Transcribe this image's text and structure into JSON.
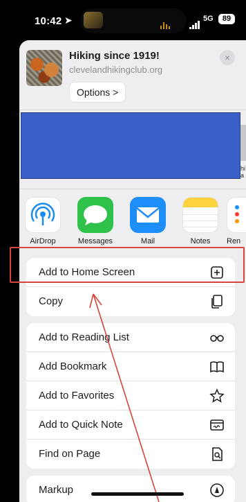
{
  "status_bar": {
    "time": "10:42",
    "network": "5G",
    "battery": "89"
  },
  "share_preview": {
    "title": "Hiking since 1919!",
    "url": "clevelandhikingclub.org",
    "options_label": "Options >",
    "close_symbol": "×"
  },
  "banner_peek_text": "hi\na",
  "apps": [
    {
      "label": "AirDrop",
      "icon": "airdrop-icon"
    },
    {
      "label": "Messages",
      "icon": "messages-icon"
    },
    {
      "label": "Mail",
      "icon": "mail-icon"
    },
    {
      "label": "Notes",
      "icon": "notes-icon"
    },
    {
      "label": "Ren",
      "icon": "reminders-icon"
    }
  ],
  "actions_group1": [
    {
      "label": "Add to Home Screen",
      "icon": "plus-square-icon"
    },
    {
      "label": "Copy",
      "icon": "copy-icon"
    }
  ],
  "actions_group2": [
    {
      "label": "Add to Reading List",
      "icon": "glasses-icon"
    },
    {
      "label": "Add Bookmark",
      "icon": "book-icon"
    },
    {
      "label": "Add to Favorites",
      "icon": "star-icon"
    },
    {
      "label": "Add to Quick Note",
      "icon": "quick-note-icon"
    },
    {
      "label": "Find on Page",
      "icon": "find-on-page-icon"
    }
  ],
  "actions_group3": [
    {
      "label": "Markup",
      "icon": "markup-icon"
    }
  ],
  "colors": {
    "annotation": "#d9443a",
    "banner": "#3a60c8",
    "messages": "#2fc24a",
    "mail": "#1d8df7"
  }
}
